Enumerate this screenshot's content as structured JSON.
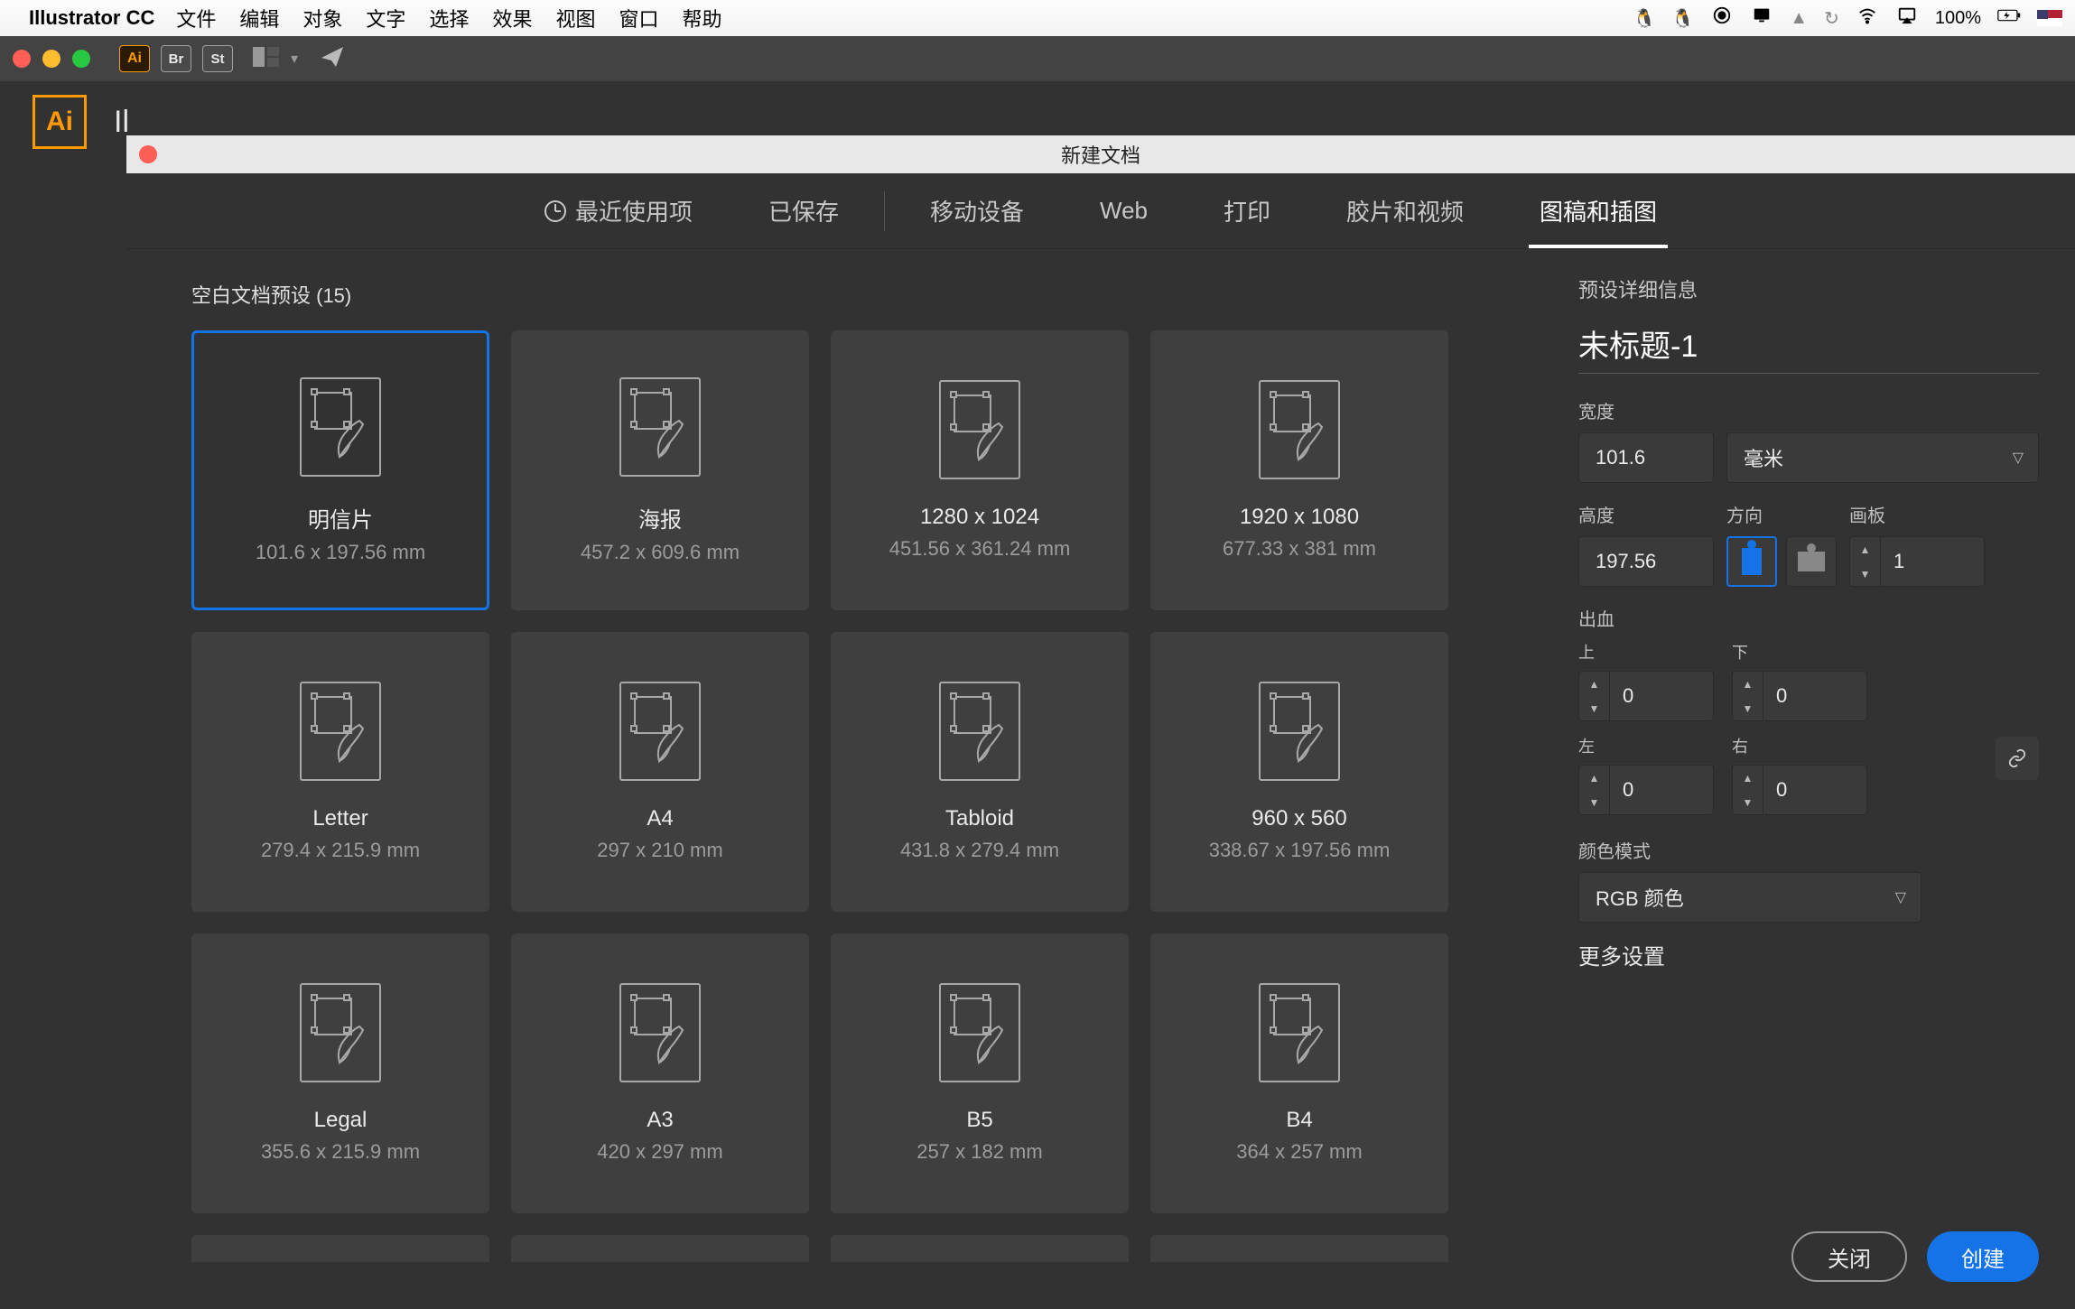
{
  "menubar": {
    "app_name": "Illustrator CC",
    "items": [
      "文件",
      "编辑",
      "对象",
      "文字",
      "选择",
      "效果",
      "视图",
      "窗口",
      "帮助"
    ],
    "battery_pct": "100%"
  },
  "app_strip": {
    "badges": [
      "Ai",
      "Br",
      "St"
    ]
  },
  "app_header": {
    "logo_text": "Ai",
    "truncated": "Il"
  },
  "modal": {
    "title": "新建文档",
    "tabs": [
      "最近使用项",
      "已保存",
      "移动设备",
      "Web",
      "打印",
      "胶片和视频",
      "图稿和插图"
    ],
    "active_tab_index": 6,
    "presets_header": "空白文档预设  (15)",
    "presets": [
      {
        "name": "明信片",
        "size": "101.6 x 197.56 mm",
        "selected": true
      },
      {
        "name": "海报",
        "size": "457.2 x 609.6 mm"
      },
      {
        "name": "1280 x 1024",
        "size": "451.56 x 361.24 mm"
      },
      {
        "name": "1920 x 1080",
        "size": "677.33 x 381 mm"
      },
      {
        "name": "Letter",
        "size": "279.4 x 215.9 mm"
      },
      {
        "name": "A4",
        "size": "297 x 210 mm"
      },
      {
        "name": "Tabloid",
        "size": "431.8 x 279.4 mm"
      },
      {
        "name": "960 x 560",
        "size": "338.67 x 197.56 mm"
      },
      {
        "name": "Legal",
        "size": "355.6 x 215.9 mm"
      },
      {
        "name": "A3",
        "size": "420 x 297 mm"
      },
      {
        "name": "B5",
        "size": "257 x 182 mm"
      },
      {
        "name": "B4",
        "size": "364 x 257 mm"
      }
    ],
    "details": {
      "section_title": "预设详细信息",
      "doc_name": "未标题-1",
      "width_label": "宽度",
      "width_value": "101.6",
      "unit_value": "毫米",
      "height_label": "高度",
      "height_value": "197.56",
      "orient_label": "方向",
      "artboards_label": "画板",
      "artboards_value": "1",
      "bleed_label": "出血",
      "bleed_top_label": "上",
      "bleed_bottom_label": "下",
      "bleed_left_label": "左",
      "bleed_right_label": "右",
      "bleed_top": "0",
      "bleed_bottom": "0",
      "bleed_left": "0",
      "bleed_right": "0",
      "colormode_label": "颜色模式",
      "colormode_value": "RGB 颜色",
      "more_label": "更多设置",
      "btn_close": "关闭",
      "btn_create": "创建"
    }
  }
}
